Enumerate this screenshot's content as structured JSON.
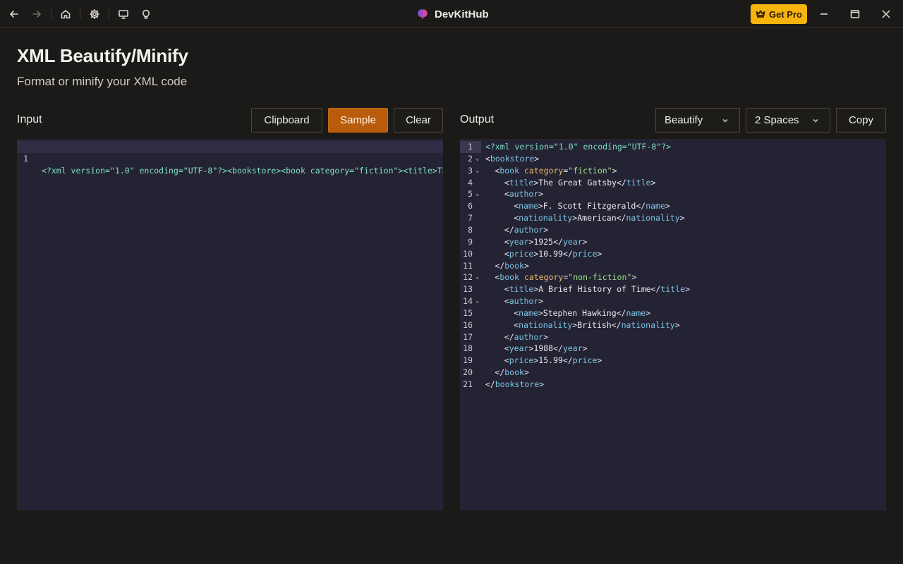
{
  "app": {
    "name": "DevKitHub",
    "get_pro_label": "Get Pro",
    "accent": "#b85c0c",
    "pro_color": "#f7b40f"
  },
  "toolbar_icons": [
    "back-arrow-icon",
    "forward-arrow-icon",
    "home-icon",
    "gear-icon",
    "monitor-icon",
    "lightbulb-icon"
  ],
  "page": {
    "title": "XML Beautify/Minify",
    "subtitle": "Format or minify your XML code"
  },
  "input": {
    "label": "Input",
    "buttons": {
      "clipboard": "Clipboard",
      "sample": "Sample",
      "clear": "Clear"
    },
    "line_number": "1",
    "line_text": "<?xml version=\"1.0\" encoding=\"UTF-8\"?><bookstore><book category=\"fiction\"><title>The Gr"
  },
  "output": {
    "label": "Output",
    "mode_select": "Beautify",
    "indent_select": "2 Spaces",
    "copy_label": "Copy",
    "lines": [
      {
        "n": "1",
        "fold": false,
        "indent": 0,
        "tokens": [
          [
            "decl",
            "<?xml version=\"1.0\" encoding=\"UTF-8\"?>"
          ]
        ]
      },
      {
        "n": "2",
        "fold": true,
        "indent": 0,
        "tokens": [
          [
            "punc",
            "<"
          ],
          [
            "tag",
            "bookstore"
          ],
          [
            "punc",
            ">"
          ]
        ]
      },
      {
        "n": "3",
        "fold": true,
        "indent": 1,
        "tokens": [
          [
            "punc",
            "<"
          ],
          [
            "tag",
            "book"
          ],
          [
            "punc",
            " "
          ],
          [
            "attr",
            "category"
          ],
          [
            "punc",
            "="
          ],
          [
            "str",
            "\"fiction\""
          ],
          [
            "punc",
            ">"
          ]
        ]
      },
      {
        "n": "4",
        "fold": false,
        "indent": 2,
        "tokens": [
          [
            "punc",
            "<"
          ],
          [
            "tag",
            "title"
          ],
          [
            "punc",
            ">"
          ],
          [
            "txt",
            "The Great Gatsby"
          ],
          [
            "punc",
            "</"
          ],
          [
            "tag",
            "title"
          ],
          [
            "punc",
            ">"
          ]
        ]
      },
      {
        "n": "5",
        "fold": true,
        "indent": 2,
        "tokens": [
          [
            "punc",
            "<"
          ],
          [
            "tag",
            "author"
          ],
          [
            "punc",
            ">"
          ]
        ]
      },
      {
        "n": "6",
        "fold": false,
        "indent": 3,
        "tokens": [
          [
            "punc",
            "<"
          ],
          [
            "tag",
            "name"
          ],
          [
            "punc",
            ">"
          ],
          [
            "txt",
            "F. Scott Fitzgerald"
          ],
          [
            "punc",
            "</"
          ],
          [
            "tag",
            "name"
          ],
          [
            "punc",
            ">"
          ]
        ]
      },
      {
        "n": "7",
        "fold": false,
        "indent": 3,
        "tokens": [
          [
            "punc",
            "<"
          ],
          [
            "tag",
            "nationality"
          ],
          [
            "punc",
            ">"
          ],
          [
            "txt",
            "American"
          ],
          [
            "punc",
            "</"
          ],
          [
            "tag",
            "nationality"
          ],
          [
            "punc",
            ">"
          ]
        ]
      },
      {
        "n": "8",
        "fold": false,
        "indent": 2,
        "tokens": [
          [
            "punc",
            "</"
          ],
          [
            "tag",
            "author"
          ],
          [
            "punc",
            ">"
          ]
        ]
      },
      {
        "n": "9",
        "fold": false,
        "indent": 2,
        "tokens": [
          [
            "punc",
            "<"
          ],
          [
            "tag",
            "year"
          ],
          [
            "punc",
            ">"
          ],
          [
            "txt",
            "1925"
          ],
          [
            "punc",
            "</"
          ],
          [
            "tag",
            "year"
          ],
          [
            "punc",
            ">"
          ]
        ]
      },
      {
        "n": "10",
        "fold": false,
        "indent": 2,
        "tokens": [
          [
            "punc",
            "<"
          ],
          [
            "tag",
            "price"
          ],
          [
            "punc",
            ">"
          ],
          [
            "txt",
            "10.99"
          ],
          [
            "punc",
            "</"
          ],
          [
            "tag",
            "price"
          ],
          [
            "punc",
            ">"
          ]
        ]
      },
      {
        "n": "11",
        "fold": false,
        "indent": 1,
        "tokens": [
          [
            "punc",
            "</"
          ],
          [
            "tag",
            "book"
          ],
          [
            "punc",
            ">"
          ]
        ]
      },
      {
        "n": "12",
        "fold": true,
        "indent": 1,
        "tokens": [
          [
            "punc",
            "<"
          ],
          [
            "tag",
            "book"
          ],
          [
            "punc",
            " "
          ],
          [
            "attr",
            "category"
          ],
          [
            "punc",
            "="
          ],
          [
            "str",
            "\"non-fiction\""
          ],
          [
            "punc",
            ">"
          ]
        ]
      },
      {
        "n": "13",
        "fold": false,
        "indent": 2,
        "tokens": [
          [
            "punc",
            "<"
          ],
          [
            "tag",
            "title"
          ],
          [
            "punc",
            ">"
          ],
          [
            "txt",
            "A Brief History of Time"
          ],
          [
            "punc",
            "</"
          ],
          [
            "tag",
            "title"
          ],
          [
            "punc",
            ">"
          ]
        ]
      },
      {
        "n": "14",
        "fold": true,
        "indent": 2,
        "tokens": [
          [
            "punc",
            "<"
          ],
          [
            "tag",
            "author"
          ],
          [
            "punc",
            ">"
          ]
        ]
      },
      {
        "n": "15",
        "fold": false,
        "indent": 3,
        "tokens": [
          [
            "punc",
            "<"
          ],
          [
            "tag",
            "name"
          ],
          [
            "punc",
            ">"
          ],
          [
            "txt",
            "Stephen Hawking"
          ],
          [
            "punc",
            "</"
          ],
          [
            "tag",
            "name"
          ],
          [
            "punc",
            ">"
          ]
        ]
      },
      {
        "n": "16",
        "fold": false,
        "indent": 3,
        "tokens": [
          [
            "punc",
            "<"
          ],
          [
            "tag",
            "nationality"
          ],
          [
            "punc",
            ">"
          ],
          [
            "txt",
            "British"
          ],
          [
            "punc",
            "</"
          ],
          [
            "tag",
            "nationality"
          ],
          [
            "punc",
            ">"
          ]
        ]
      },
      {
        "n": "17",
        "fold": false,
        "indent": 2,
        "tokens": [
          [
            "punc",
            "</"
          ],
          [
            "tag",
            "author"
          ],
          [
            "punc",
            ">"
          ]
        ]
      },
      {
        "n": "18",
        "fold": false,
        "indent": 2,
        "tokens": [
          [
            "punc",
            "<"
          ],
          [
            "tag",
            "year"
          ],
          [
            "punc",
            ">"
          ],
          [
            "txt",
            "1988"
          ],
          [
            "punc",
            "</"
          ],
          [
            "tag",
            "year"
          ],
          [
            "punc",
            ">"
          ]
        ]
      },
      {
        "n": "19",
        "fold": false,
        "indent": 2,
        "tokens": [
          [
            "punc",
            "<"
          ],
          [
            "tag",
            "price"
          ],
          [
            "punc",
            ">"
          ],
          [
            "txt",
            "15.99"
          ],
          [
            "punc",
            "</"
          ],
          [
            "tag",
            "price"
          ],
          [
            "punc",
            ">"
          ]
        ]
      },
      {
        "n": "20",
        "fold": false,
        "indent": 1,
        "tokens": [
          [
            "punc",
            "</"
          ],
          [
            "tag",
            "book"
          ],
          [
            "punc",
            ">"
          ]
        ]
      },
      {
        "n": "21",
        "fold": false,
        "indent": 0,
        "tokens": [
          [
            "punc",
            "</"
          ],
          [
            "tag",
            "bookstore"
          ],
          [
            "punc",
            ">"
          ]
        ]
      }
    ]
  }
}
